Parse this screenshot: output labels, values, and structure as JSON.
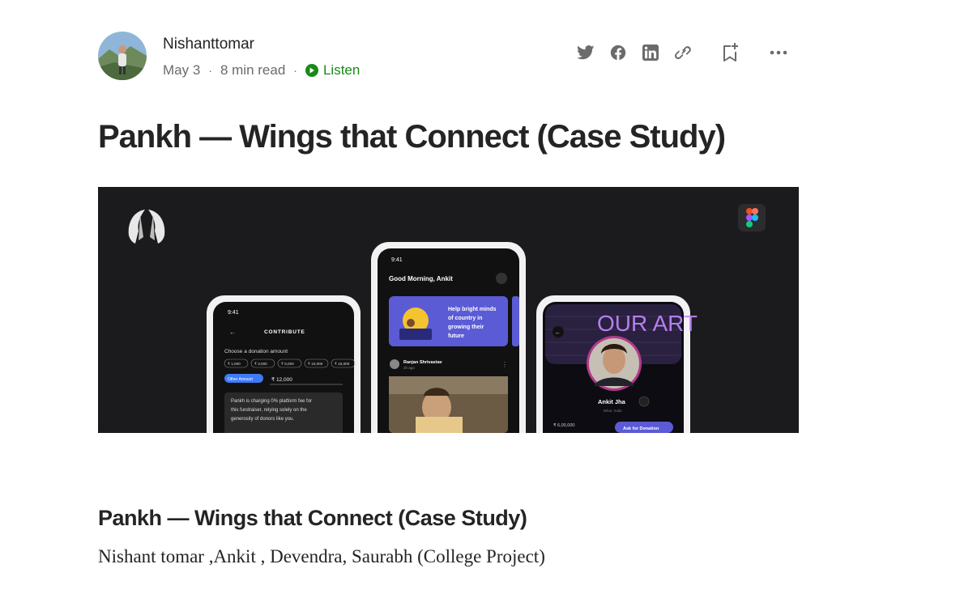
{
  "author": {
    "name": "Nishanttomar",
    "date": "May 3",
    "read_time": "8 min read",
    "listen_label": "Listen"
  },
  "actions": {
    "icons": [
      "twitter-icon",
      "facebook-icon",
      "linkedin-icon",
      "link-icon",
      "bookmark-add-icon",
      "more-icon"
    ]
  },
  "article": {
    "title": "Pankh — Wings that Connect (Case Study)",
    "subtitle": "Pankh — Wings that Connect (Case Study)",
    "authors_line": "Nishant tomar ,Ankit , Devendra, Saurabh (College Project)"
  },
  "hero": {
    "phone_left": {
      "time": "9:41",
      "header": "CONTRIBUTE",
      "prompt": "Choose a donation amount",
      "amounts": [
        "₹ 1,000",
        "₹ 3,000",
        "₹ 5,000",
        "₹ 10,000",
        "₹ 15,000"
      ],
      "other_label": "Other Amount",
      "other_value": "₹ 12,000",
      "note": "Pankh is charging 0% platform fee for this fundraiser, relying solely on the generosity of donors like you."
    },
    "phone_middle": {
      "time": "9:41",
      "greeting": "Good Morning, Ankit",
      "banner": "Help bright minds of country in growing their future",
      "poster_name": "Ranjan Shrivastav",
      "poster_time": "2h ago"
    },
    "phone_right": {
      "cover_text": "OUR ART",
      "name": "Ankit Jha",
      "location": "Bihar, India",
      "amount": "₹ 6,00,000",
      "button": "Ask for Donation"
    }
  },
  "colors": {
    "accent_green": "#1a8917",
    "text_dark": "#242424",
    "text_muted": "#6b6b6b",
    "hero_bg": "#1b1b1d",
    "phone_accent": "#5b5bd6"
  }
}
